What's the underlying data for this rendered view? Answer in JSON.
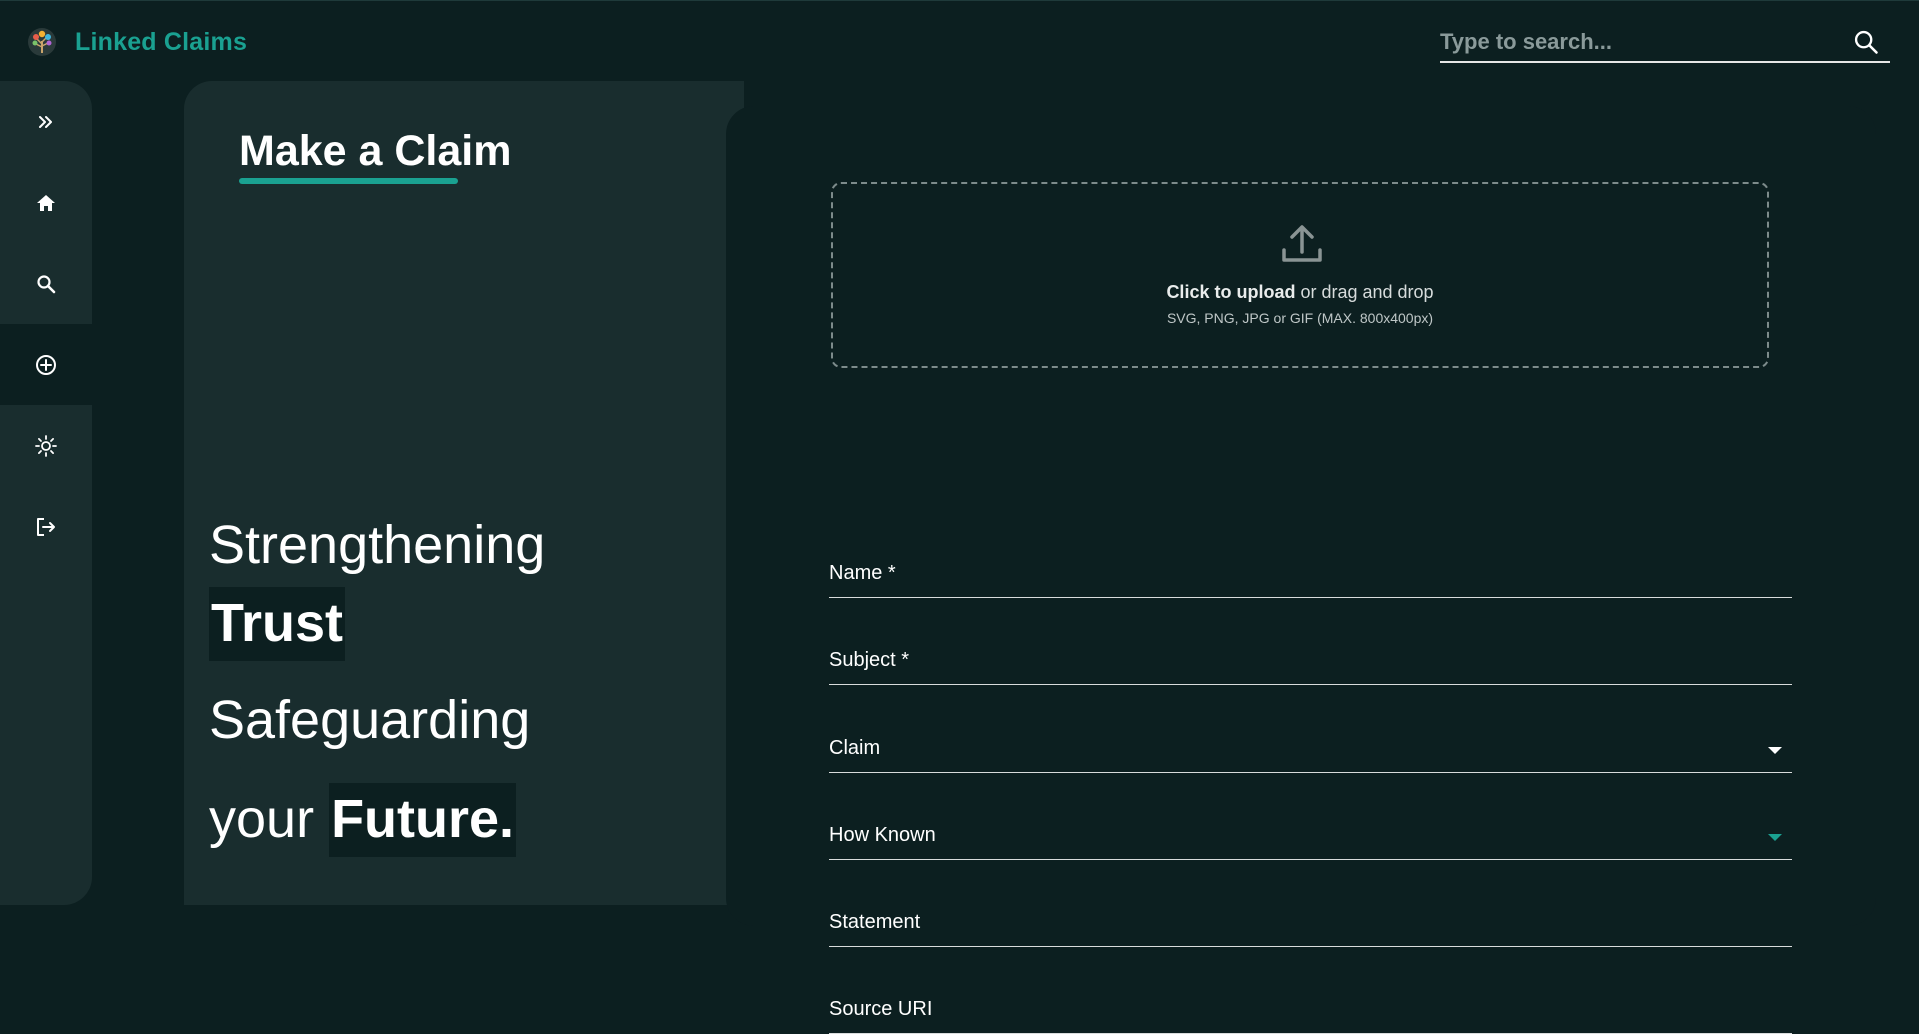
{
  "app": {
    "name": "Linked Claims",
    "logo_icon": "tree-logo-icon"
  },
  "search": {
    "placeholder": "Type to search...",
    "icon": "search-icon"
  },
  "sidebar": {
    "items": [
      {
        "icon": "expand-double-chevron-icon",
        "active": false
      },
      {
        "icon": "home-icon",
        "active": false
      },
      {
        "icon": "search-icon",
        "active": false
      },
      {
        "icon": "add-circle-icon",
        "active": true
      },
      {
        "icon": "sun-theme-icon",
        "active": false
      },
      {
        "icon": "logout-icon",
        "active": false
      }
    ]
  },
  "hero": {
    "title": "Make a Claim",
    "line1": "Strengthening",
    "line2": "Trust",
    "line3": "Safeguarding",
    "line4_prefix": "your",
    "line4_highlight": "Future."
  },
  "form": {
    "upload": {
      "icon": "upload-icon",
      "click_text": "Click to upload",
      "rest_text": " or drag and drop",
      "hint": "SVG, PNG, JPG or GIF (MAX. 800x400px)"
    },
    "fields": {
      "name": "Name *",
      "subject": "Subject *",
      "claim": "Claim",
      "how_known": "How Known",
      "statement": "Statement",
      "source_url": "Source URI"
    }
  },
  "colors": {
    "background": "#0c1f20",
    "panel": "#192d2e",
    "accent": "#1aa191",
    "text": "#ffffff"
  }
}
